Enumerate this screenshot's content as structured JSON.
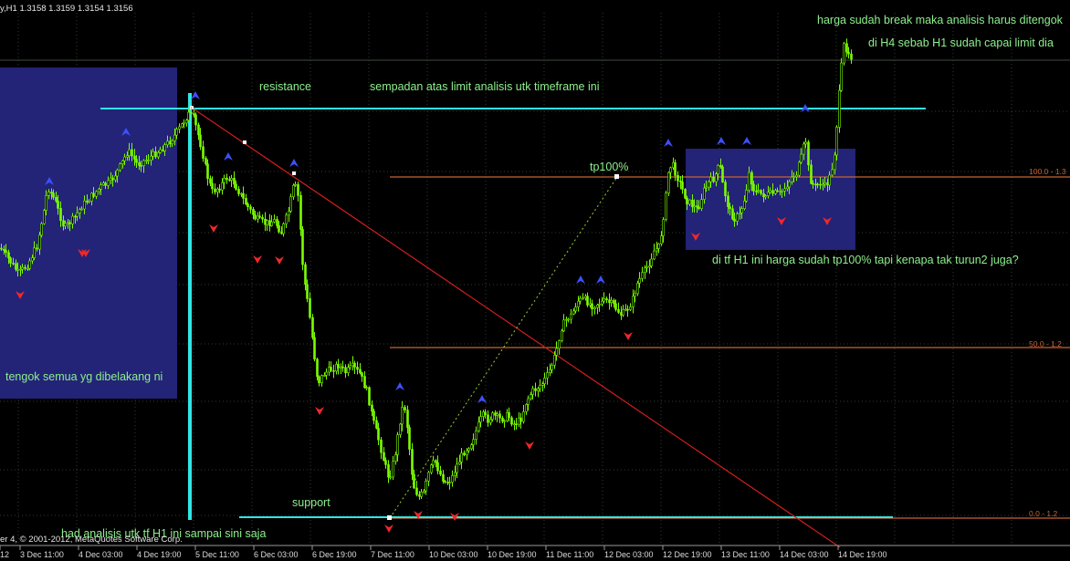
{
  "chart_data": {
    "type": "candlestick",
    "symbol_header": "y,H1  1.3158 1.3159 1.3154 1.3156",
    "copyright": "er 4, © 2001-2012, MetaQuotes Software Corp.",
    "x_ticks": [
      "12",
      "3 Dec 11:00",
      "4 Dec 03:00",
      "4 Dec 19:00",
      "5 Dec 11:00",
      "6 Dec 03:00",
      "6 Dec 19:00",
      "7 Dec 11:00",
      "10 Dec 03:00",
      "10 Dec 19:00",
      "11 Dec 11:00",
      "12 Dec 03:00",
      "12 Dec 19:00",
      "13 Dec 11:00",
      "14 Dec 03:00",
      "14 Dec 19:00"
    ],
    "close_path": [
      [
        0,
        0.56
      ],
      [
        4,
        0.545
      ],
      [
        8,
        0.575
      ],
      [
        12,
        0.555
      ],
      [
        16,
        0.59
      ],
      [
        20,
        0.6
      ],
      [
        24,
        0.58
      ],
      [
        28,
        0.595
      ],
      [
        32,
        0.585
      ],
      [
        36,
        0.605
      ],
      [
        40,
        0.6
      ],
      [
        44,
        0.58
      ],
      [
        48,
        0.56
      ],
      [
        52,
        0.5
      ],
      [
        56,
        0.47
      ],
      [
        60,
        0.44
      ],
      [
        64,
        0.45
      ],
      [
        68,
        0.42
      ],
      [
        72,
        0.41
      ],
      [
        76,
        0.43
      ],
      [
        80,
        0.4
      ],
      [
        84,
        0.39
      ],
      [
        88,
        0.42
      ],
      [
        92,
        0.4
      ],
      [
        96,
        0.38
      ],
      [
        100,
        0.36
      ],
      [
        104,
        0.35
      ],
      [
        108,
        0.33
      ],
      [
        112,
        0.34
      ],
      [
        116,
        0.32
      ],
      [
        120,
        0.31
      ],
      [
        124,
        0.29
      ],
      [
        128,
        0.3
      ],
      [
        132,
        0.27
      ],
      [
        136,
        0.25
      ],
      [
        140,
        0.24
      ],
      [
        144,
        0.27
      ],
      [
        148,
        0.26
      ],
      [
        152,
        0.245
      ],
      [
        156,
        0.255
      ],
      [
        160,
        0.25
      ],
      [
        164,
        0.24
      ],
      [
        168,
        0.22
      ],
      [
        172,
        0.245
      ],
      [
        176,
        0.235
      ],
      [
        180,
        0.225
      ],
      [
        184,
        0.23
      ],
      [
        188,
        0.2
      ],
      [
        192,
        0.19
      ],
      [
        196,
        0.2
      ],
      [
        200,
        0.18
      ],
      [
        204,
        0.19
      ],
      [
        208,
        0.15
      ],
      [
        212,
        0.165
      ],
      [
        216,
        0.2
      ],
      [
        220,
        0.26
      ],
      [
        224,
        0.3
      ],
      [
        228,
        0.34
      ],
      [
        232,
        0.37
      ],
      [
        236,
        0.36
      ],
      [
        240,
        0.34
      ],
      [
        244,
        0.35
      ],
      [
        248,
        0.37
      ],
      [
        252,
        0.345
      ],
      [
        256,
        0.36
      ],
      [
        260,
        0.38
      ],
      [
        264,
        0.37
      ],
      [
        268,
        0.4
      ],
      [
        272,
        0.42
      ],
      [
        276,
        0.4
      ],
      [
        280,
        0.41
      ],
      [
        284,
        0.4
      ],
      [
        288,
        0.395
      ],
      [
        292,
        0.41
      ],
      [
        296,
        0.43
      ],
      [
        300,
        0.46
      ],
      [
        304,
        0.47
      ],
      [
        308,
        0.49
      ],
      [
        312,
        0.48
      ],
      [
        316,
        0.38
      ],
      [
        320,
        0.33
      ],
      [
        324,
        0.36
      ],
      [
        328,
        0.32
      ],
      [
        332,
        0.5
      ],
      [
        336,
        0.6
      ],
      [
        340,
        0.66
      ],
      [
        344,
        0.68
      ],
      [
        348,
        0.73
      ],
      [
        352,
        0.76
      ],
      [
        356,
        0.76
      ],
      [
        360,
        0.74
      ],
      [
        364,
        0.73
      ],
      [
        368,
        0.76
      ],
      [
        372,
        0.77
      ],
      [
        376,
        0.79
      ],
      [
        380,
        0.83
      ],
      [
        384,
        0.85
      ],
      [
        388,
        0.86
      ],
      [
        392,
        0.89
      ],
      [
        396,
        0.91
      ],
      [
        400,
        0.93
      ],
      [
        404,
        0.95
      ],
      [
        408,
        0.96
      ],
      [
        412,
        0.95
      ],
      [
        416,
        0.93
      ],
      [
        420,
        0.94
      ],
      [
        424,
        0.95
      ],
      [
        428,
        0.94
      ],
      [
        432,
        0.96
      ],
      [
        436,
        0.99
      ],
      [
        440,
        1.01
      ],
      [
        444,
        1.03
      ],
      [
        448,
        1.04
      ],
      [
        452,
        1.04
      ],
      [
        456,
        1.02
      ],
      [
        460,
        1.06
      ],
      [
        464,
        1.06
      ],
      [
        468,
        1.1
      ],
      [
        472,
        1.08
      ],
      [
        476,
        1.0
      ],
      [
        480,
        0.97
      ],
      [
        484,
        1.01
      ],
      [
        488,
        1.05
      ],
      [
        492,
        1.0
      ],
      [
        496,
        0.98
      ],
      [
        500,
        0.99
      ],
      [
        504,
        1.03
      ],
      [
        508,
        0.99
      ],
      [
        512,
        1.01
      ],
      [
        516,
        0.98
      ],
      [
        520,
        0.99
      ],
      [
        524,
        0.99
      ],
      [
        528,
        1.01
      ],
      [
        532,
        1.06
      ],
      [
        536,
        1.02
      ],
      [
        540,
        1.01
      ],
      [
        544,
        1.0
      ],
      [
        548,
        1.02
      ],
      [
        552,
        1.0
      ],
      [
        556,
        0.99
      ],
      [
        560,
        1.02
      ],
      [
        564,
        1.15
      ],
      [
        568,
        1.4
      ],
      [
        572,
        1.3
      ],
      [
        576,
        1.28
      ]
    ],
    "horizontal_levels": [
      {
        "name": "resistance",
        "value": 1.15
      },
      {
        "name": "support",
        "value": 0.0
      }
    ],
    "fibonacci_levels": [
      {
        "label": "100.0 - 1.3",
        "value": 1.0
      },
      {
        "label": "50.0 - 1.2",
        "value": 0.5
      },
      {
        "label": "0.0 - 1.2",
        "value": 0.0
      }
    ],
    "annotations": [
      {
        "text": "harga sudah break maka analisis harus ditengok"
      },
      {
        "text": "di H4 sebab H1 sudah capai limit dia"
      },
      {
        "text": "resistance"
      },
      {
        "text": "sempadan atas limit analisis utk timeframe ini"
      },
      {
        "text": "tp100%"
      },
      {
        "text": "di tf H1 ini harga sudah tp100% tapi kenapa tak turun2 juga?"
      },
      {
        "text": "tengok semua yg dibelakang ni"
      },
      {
        "text": "support"
      },
      {
        "text": "had analisis utk tf H1 ini sampai sini saja"
      }
    ],
    "colors": {
      "background": "#000000",
      "candles": "#7CFC00",
      "highlight_box": "#232378",
      "cyan_lines": "#30E6E6",
      "fib_lines": "#C86432",
      "trendline": "#D21E1E",
      "text": "#8CF08C",
      "grid": "#2E3B2E",
      "up_arrow": "#3C50FF",
      "down_arrow": "#F02828"
    }
  }
}
